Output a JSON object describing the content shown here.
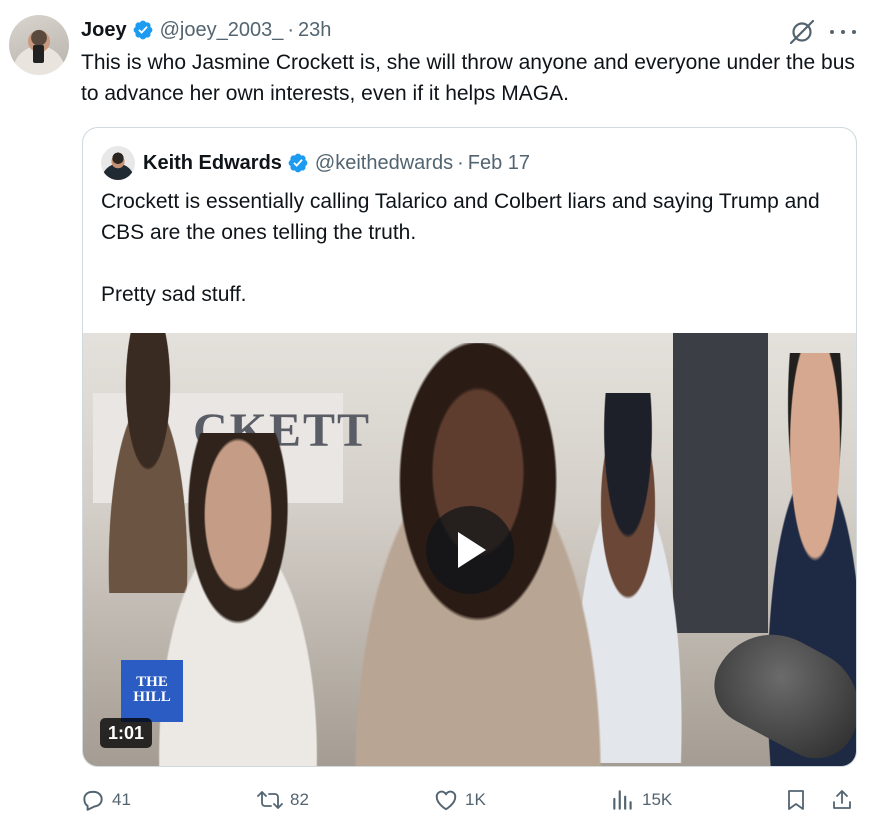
{
  "tweet": {
    "author_name": "Joey",
    "author_handle": "@joey_2003_",
    "separator": "·",
    "time": "23h",
    "text": "This is who Jasmine Crockett is, she will throw anyone and everyone under the bus to advance her own interests, even if it helps MAGA."
  },
  "quote": {
    "author_name": "Keith Edwards",
    "author_handle": "@keithedwards",
    "separator": "·",
    "time": "Feb 17",
    "paragraphs": [
      "Crockett is essentially calling Talarico and Colbert liars and saying Trump and CBS are the ones telling the truth.",
      "Pretty sad stuff."
    ],
    "media": {
      "logo_line1": "THE",
      "logo_line2": "HILL",
      "sign_text": "CKETT",
      "duration": "1:01"
    }
  },
  "actions": {
    "replies": "41",
    "retweets": "82",
    "likes": "1K",
    "views": "15K"
  },
  "colors": {
    "verified_blue": "#1d9bf0",
    "secondary_text": "#536471",
    "hill_blue": "#2b5cc4"
  },
  "icons": [
    "verified-badge-icon",
    "grok-icon",
    "more-icon",
    "play-icon",
    "reply-icon",
    "retweet-icon",
    "like-icon",
    "views-icon",
    "bookmark-icon",
    "share-icon"
  ]
}
